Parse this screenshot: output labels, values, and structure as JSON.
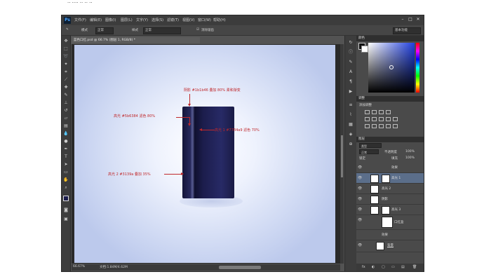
{
  "caption": "·· ···· ·· ·· ··",
  "app": {
    "logo": "Ps",
    "menu": [
      "文件(F)",
      "编辑(E)",
      "图像(I)",
      "图层(L)",
      "文字(Y)",
      "选择(S)",
      "滤镜(T)",
      "视图(V)",
      "窗口(W)",
      "帮助(H)"
    ],
    "window_controls": [
      "–",
      "□",
      "✕"
    ]
  },
  "options_bar": {
    "mode_label": "模式",
    "mode_value": "正常",
    "style_label": "样式",
    "style_value": "正常",
    "checkbox_label": "消除锯齿",
    "workspace_value": "基本功能"
  },
  "document": {
    "tab_label": "蓝色口红.psd @ 66.7% (图层 1, RGB/8) *",
    "status_zoom": "66.67%",
    "status_doc": "文档:1.84M/4.62M"
  },
  "annotations": [
    {
      "text": "阴影 #1b1b46 叠加 80% 柔和渐变",
      "arrow": "down"
    },
    {
      "text": "高光 #5b6384 滤色 80%",
      "arrow": "down"
    },
    {
      "text": "高光 1 #7784a9 滤色 70%",
      "arrow": "left"
    },
    {
      "text": "高光 2 #3139a 叠加 35%",
      "arrow": "right"
    }
  ],
  "panels": {
    "color_tab": "颜色",
    "adjust_tab": "调整",
    "adjust_title": "添加调整",
    "layers_tab": "图层",
    "layers_kind": "类型",
    "blend_mode": "正常",
    "opacity_label": "不透明度",
    "opacity_value": "100%",
    "lock_label": "锁定",
    "fill_label": "填充",
    "fill_value": "100%",
    "layers": [
      {
        "name": "效果",
        "selected": false
      },
      {
        "name": "高光 1",
        "selected": true
      },
      {
        "name": "高光 2",
        "selected": false
      },
      {
        "name": "阴影",
        "selected": false
      },
      {
        "name": "高光 3",
        "selected": false
      },
      {
        "name": "口红盒",
        "selected": false
      },
      {
        "name": "效果",
        "selected": false
      },
      {
        "name": "背景",
        "selected": false
      }
    ],
    "footer_icons": [
      "fx",
      "◐",
      "▢",
      "▭",
      "▤",
      "🗑"
    ]
  },
  "colors": {
    "accent_red": "#c0282b",
    "ps_dark": "#535353",
    "product_navy": "#1c1d4c",
    "canvas_bg": "#cfd9f3"
  }
}
